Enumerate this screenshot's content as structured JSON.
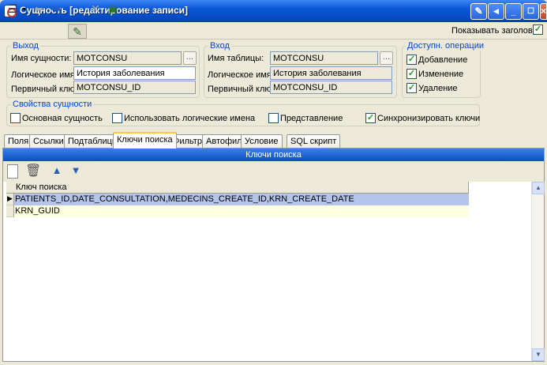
{
  "window": {
    "title": "Сущность [редактирование записи]"
  },
  "toolbar": {
    "show_header_label": "Показывать заголовок",
    "show_header_checked": true
  },
  "output_group": {
    "legend": "Выход",
    "entity_name_label": "Имя сущности:",
    "entity_name_value": "MOTCONSU",
    "logical_name_label": "Логическое имя:",
    "logical_name_value": "История заболевания",
    "primary_key_label": "Первичный ключ:",
    "primary_key_value": "MOTCONSU_ID",
    "browse_label": "..."
  },
  "input_group": {
    "legend": "Вход",
    "table_name_label": "Имя таблицы:",
    "table_name_value": "MOTCONSU",
    "logical_name_label": "Логическое имя:",
    "logical_name_value": "История заболевания",
    "primary_key_label": "Первичный ключ:",
    "primary_key_value": "MOTCONSU_ID",
    "browse_label": "..."
  },
  "operations_group": {
    "legend": "Доступн. операции",
    "items": [
      {
        "label": "Добавление",
        "checked": true
      },
      {
        "label": "Изменение",
        "checked": true
      },
      {
        "label": "Удаление",
        "checked": true
      }
    ]
  },
  "properties_group": {
    "legend": "Свойства сущности",
    "items": [
      {
        "label": "Основная сущность",
        "checked": false
      },
      {
        "label": "Использовать логические имена",
        "checked": false
      },
      {
        "label": "Представление",
        "checked": false
      },
      {
        "label": "Синхронизировать ключи",
        "checked": true
      }
    ]
  },
  "tabs": [
    {
      "label": "Поля"
    },
    {
      "label": "Ссылки"
    },
    {
      "label": "Подтаблицы"
    },
    {
      "label": "Ключи поиска",
      "active": true
    },
    {
      "label": "Фильтр"
    },
    {
      "label": "Автофильтр"
    },
    {
      "label": "Условие"
    },
    {
      "label": "SQL скрипт"
    }
  ],
  "search_keys": {
    "band_title": "Ключи поиска",
    "column_header": "Ключ поиска",
    "rows": [
      {
        "value": "PATIENTS_ID,DATE_CONSULTATION,MEDECINS_CREATE_ID,KRN_CREATE_DATE",
        "selected": true
      },
      {
        "value": "KRN_GUID",
        "selected": false
      }
    ]
  },
  "colors": {
    "accent": "#0A57D6",
    "selected_row": "#B4C4EB",
    "alt_row": "#FFFFE1",
    "legend": "#0046D5"
  }
}
